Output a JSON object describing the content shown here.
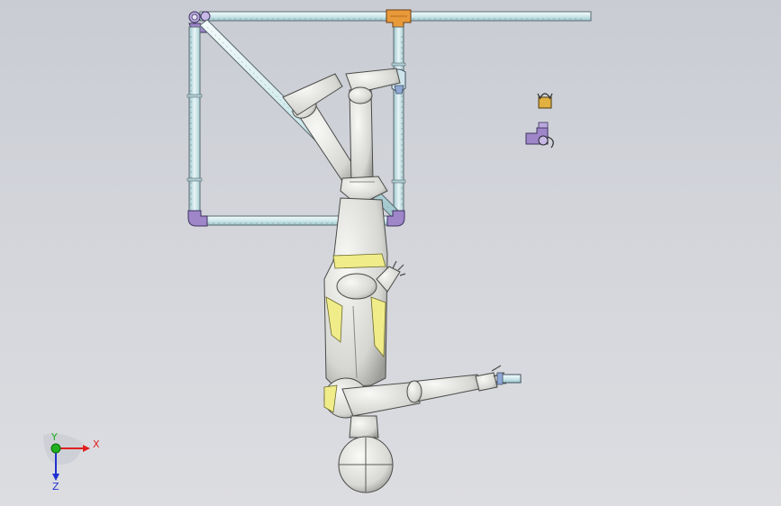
{
  "viewport": {
    "background_top": "#c9ccd3",
    "background_bottom": "#dcdde1"
  },
  "triad": {
    "x_label": "X",
    "y_label": "Y",
    "z_label": "Z",
    "x_color": "#e02020",
    "y_color": "#20b020",
    "z_color": "#2030d0"
  },
  "colors": {
    "pipe": "#d7eef0",
    "pipe_edge": "#5a6a70",
    "elbow": "#9e86c9",
    "tee": "#e89a3a",
    "body": "#e6e6e2",
    "body_edge": "#4a4a48",
    "trim": "#f0ec8a"
  }
}
